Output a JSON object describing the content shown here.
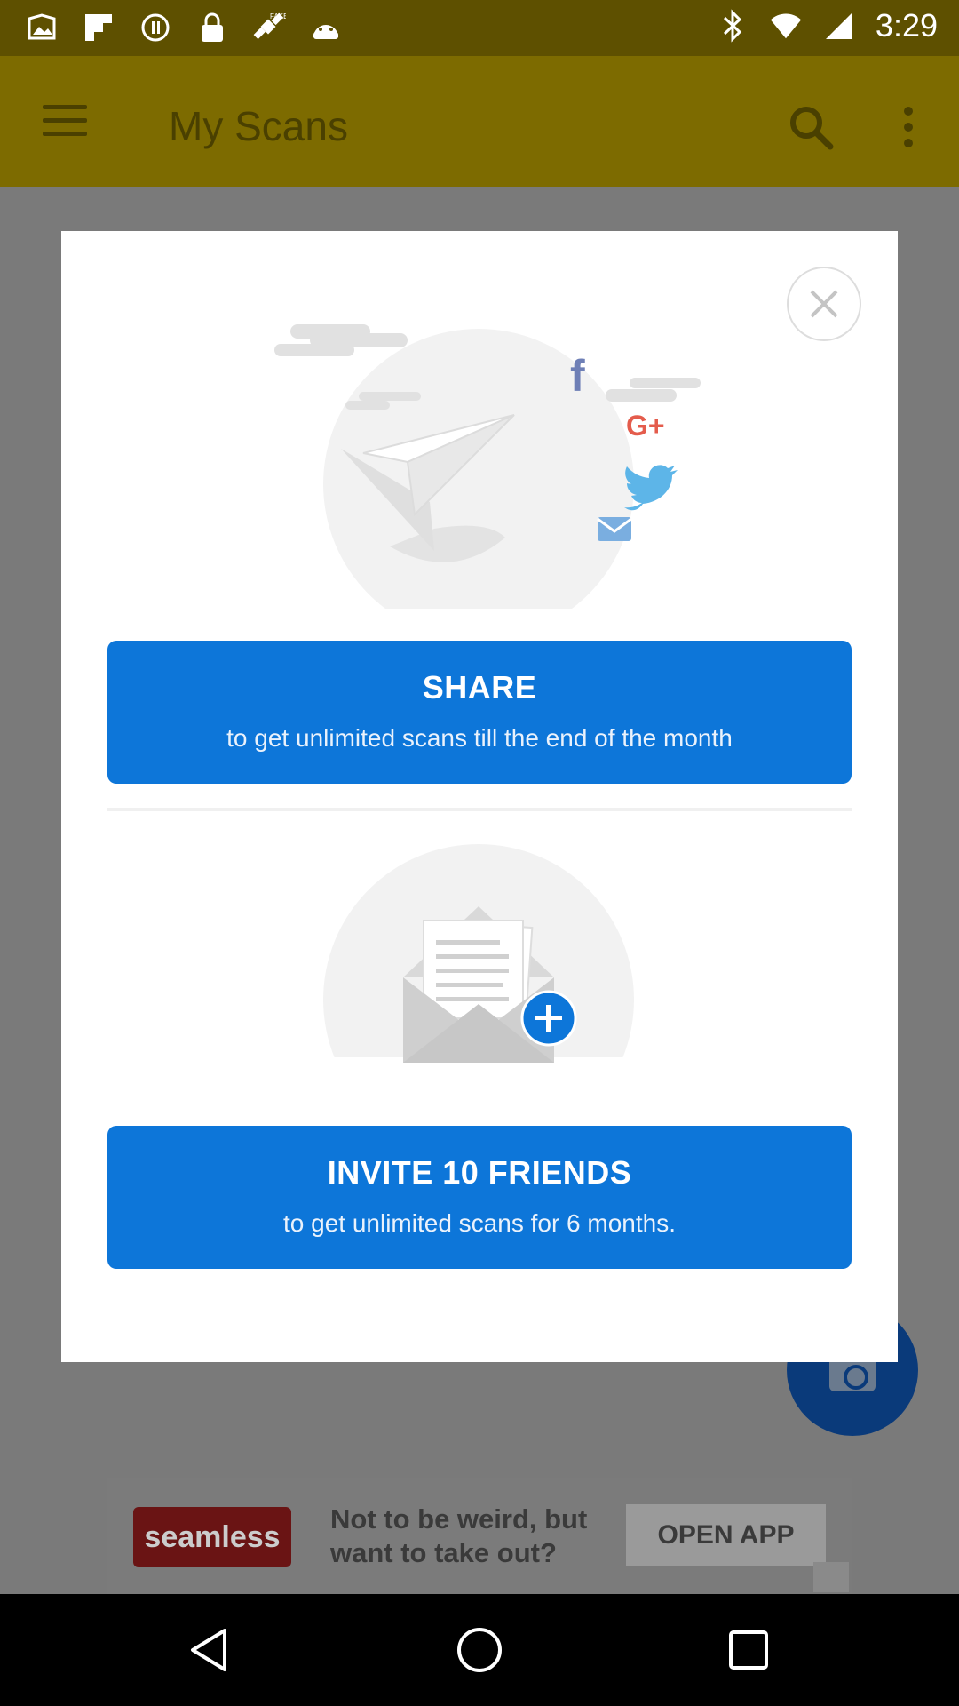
{
  "status_bar": {
    "time": "3:29",
    "left_icons": [
      "image-icon",
      "flipboard-icon",
      "sync-icon",
      "lock-icon",
      "satellite-icon",
      "android-icon"
    ],
    "right_icons": [
      "bluetooth-icon",
      "wifi-icon",
      "signal-icon"
    ],
    "fake_badge": "FAKE"
  },
  "app_bar": {
    "title": "My Scans"
  },
  "dialog": {
    "share": {
      "title": "SHARE",
      "subtitle": "to get unlimited scans till the end of the month"
    },
    "invite": {
      "title": "INVITE 10 FRIENDS",
      "subtitle": "to get unlimited scans for 6 months."
    }
  },
  "ad": {
    "brand": "seamless",
    "text": "Not to be weird, but want to take out?",
    "cta": "OPEN APP"
  },
  "colors": {
    "accent": "#0d76d9",
    "appbar": "#7d6b00",
    "scrim": "#7a7a7a"
  }
}
